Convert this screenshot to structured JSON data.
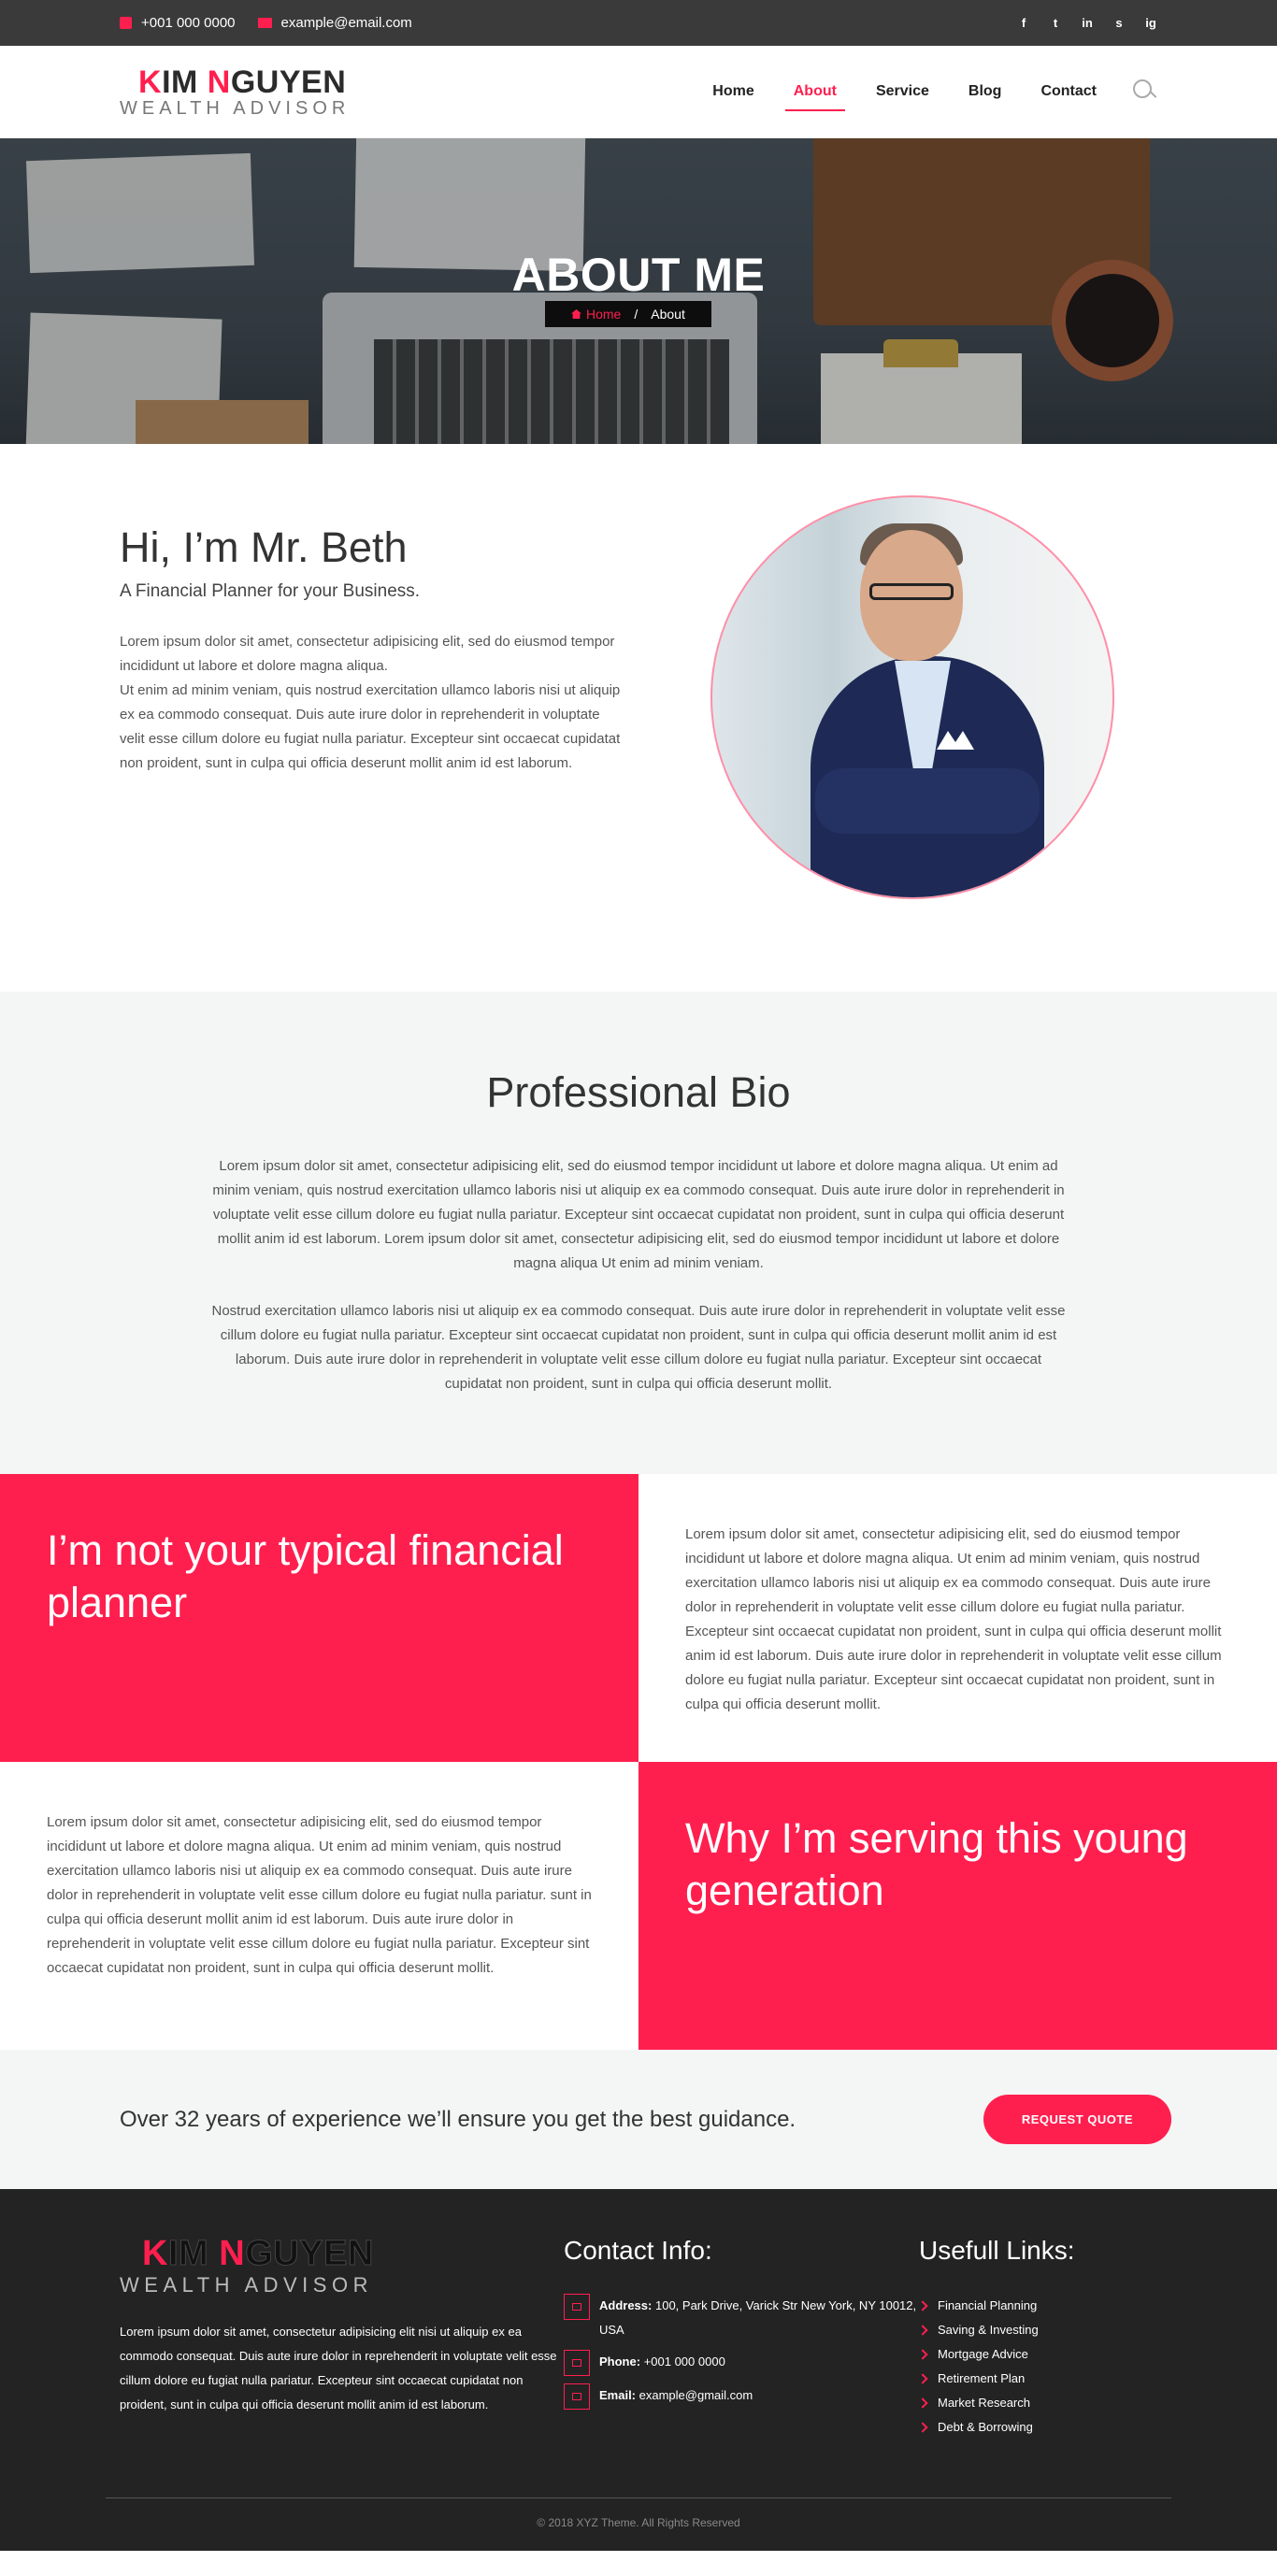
{
  "topbar": {
    "phone": "+001 000 0000",
    "email": "example@email.com",
    "socials": [
      "f",
      "t",
      "in",
      "s",
      "ig"
    ]
  },
  "brand": {
    "line1_first": "K",
    "line1_a": "IM ",
    "line1_n": "N",
    "line1_b": "GUYEN",
    "line2": "WEALTH ADVISOR",
    "accent": "#ff1f4f"
  },
  "nav": {
    "items": [
      "Home",
      "About",
      "Service",
      "Blog",
      "Contact"
    ],
    "active": "About"
  },
  "banner": {
    "title": "ABOUT ME",
    "crumb_home": "Home",
    "crumb_sep": "/",
    "crumb_current": "About"
  },
  "intro": {
    "heading": "Hi, I’m Mr. Beth",
    "subheading": "A Financial Planner for your Business.",
    "para1": "Lorem ipsum dolor sit amet, consectetur adipisicing elit, sed do eiusmod tempor incididunt ut labore et dolore magna aliqua.",
    "para2": "Ut enim ad minim veniam, quis nostrud exercitation ullamco laboris nisi ut aliquip ex ea commodo consequat. Duis aute irure dolor in reprehenderit in voluptate velit esse cillum dolore eu fugiat nulla pariatur. Excepteur sint occaecat cupidatat non proident, sunt in culpa qui officia deserunt mollit anim id est laborum."
  },
  "bio": {
    "heading": "Professional Bio",
    "para1": "Lorem ipsum dolor sit amet, consectetur adipisicing elit, sed do eiusmod tempor incididunt ut labore et dolore magna aliqua. Ut enim ad minim veniam, quis nostrud exercitation ullamco laboris nisi ut aliquip ex ea commodo consequat. Duis aute irure dolor in reprehenderit in voluptate velit esse cillum dolore eu fugiat nulla pariatur. Excepteur sint occaecat cupidatat non proident, sunt in culpa qui officia deserunt mollit anim id est laborum. Lorem ipsum dolor sit amet, consectetur adipisicing elit, sed do eiusmod tempor incididunt ut labore et dolore magna aliqua Ut enim ad minim veniam.",
    "para2": "Nostrud exercitation ullamco laboris nisi ut aliquip ex ea commodo consequat. Duis aute irure dolor in reprehenderit in voluptate velit esse cillum dolore eu fugiat nulla pariatur. Excepteur sint occaecat cupidatat non proident, sunt in culpa qui officia deserunt mollit anim id est laborum. Duis aute irure dolor in reprehenderit in voluptate velit esse cillum dolore eu fugiat nulla pariatur. Excepteur sint occaecat cupidatat non proident, sunt in culpa qui officia deserunt mollit."
  },
  "split": {
    "heading1": "I’m not your typical financial planner",
    "text1": "Lorem ipsum dolor sit amet, consectetur adipisicing elit, sed do eiusmod tempor incididunt ut labore et dolore magna aliqua. Ut enim ad minim veniam, quis nostrud exercitation ullamco laboris nisi ut aliquip ex ea commodo consequat. Duis aute irure dolor in reprehenderit in voluptate velit esse cillum dolore eu fugiat nulla pariatur. Excepteur sint occaecat cupidatat non proident, sunt in culpa qui officia deserunt mollit anim id est laborum. Duis aute irure dolor in reprehenderit in voluptate velit esse cillum dolore eu fugiat nulla pariatur. Excepteur sint occaecat cupidatat non proident, sunt in culpa qui officia deserunt mollit.",
    "text2": "Lorem ipsum dolor sit amet, consectetur adipisicing elit, sed do eiusmod tempor incididunt ut labore et dolore magna aliqua. Ut enim ad minim veniam, quis nostrud exercitation ullamco laboris nisi ut aliquip ex ea commodo consequat. Duis aute irure dolor in reprehenderit in voluptate velit esse cillum dolore eu fugiat nulla pariatur. sunt in culpa qui officia deserunt mollit anim id est laborum. Duis aute irure dolor in reprehenderit in voluptate velit esse cillum dolore eu fugiat nulla pariatur. Excepteur sint occaecat cupidatat non proident, sunt in culpa qui officia deserunt mollit.",
    "heading2": "Why I’m serving this young generation"
  },
  "cta": {
    "message": "Over 32 years of experience we’ll ensure you get the best guidance.",
    "button": "REQUEST QUOTE"
  },
  "footer": {
    "about": "Lorem ipsum dolor sit amet, consectetur adipisicing elit nisi ut aliquip ex ea commodo consequat. Duis aute irure dolor in reprehenderit in voluptate velit esse cillum dolore eu fugiat nulla pariatur. Excepteur sint occaecat cupidatat non proident, sunt in culpa qui officia deserunt mollit anim id est laborum.",
    "contact_heading": "Contact Info:",
    "address_label": "Address:",
    "address_value": "100, Park Drive, Varick Str New York, NY 10012, USA",
    "phone_label": "Phone:",
    "phone_value": "+001 000 0000",
    "email_label": "Email:",
    "email_value": "example@gmail.com",
    "links_heading": "Usefull Links:",
    "links": [
      "Financial Planning",
      "Saving & Investing",
      "Mortgage Advice",
      "Retirement Plan",
      "Market Research",
      "Debt & Borrowing"
    ],
    "copyright": "© 2018 XYZ Theme. All Rights Reserved"
  }
}
